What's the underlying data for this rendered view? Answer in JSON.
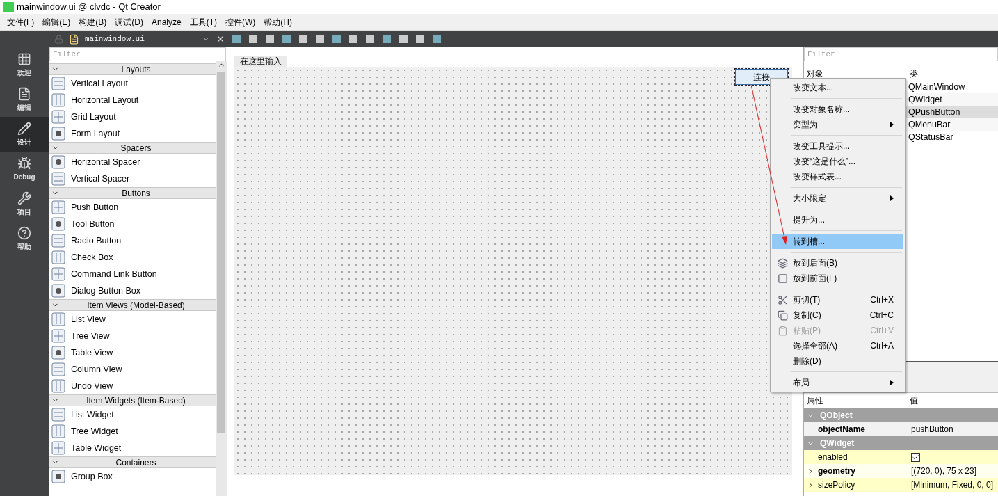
{
  "window": {
    "title": "mainwindow.ui @ clvdc - Qt Creator"
  },
  "menubar": [
    "文件(F)",
    "编辑(E)",
    "构建(B)",
    "调试(D)",
    "Analyze",
    "工具(T)",
    "控件(W)",
    "帮助(H)"
  ],
  "editor_toolbar": {
    "file": "mainwindow.ui"
  },
  "modes": [
    {
      "label": "欢迎",
      "selected": false
    },
    {
      "label": "编辑",
      "selected": false
    },
    {
      "label": "设计",
      "selected": true
    },
    {
      "label": "Debug",
      "selected": false
    },
    {
      "label": "项目",
      "selected": false
    },
    {
      "label": "帮助",
      "selected": false
    }
  ],
  "widget_box": {
    "filter_placeholder": "Filter",
    "categories": [
      {
        "title": "Layouts",
        "items": [
          "Vertical Layout",
          "Horizontal Layout",
          "Grid Layout",
          "Form Layout"
        ]
      },
      {
        "title": "Spacers",
        "items": [
          "Horizontal Spacer",
          "Vertical Spacer"
        ]
      },
      {
        "title": "Buttons",
        "items": [
          "Push Button",
          "Tool Button",
          "Radio Button",
          "Check Box",
          "Command Link Button",
          "Dialog Button Box"
        ]
      },
      {
        "title": "Item Views (Model-Based)",
        "items": [
          "List View",
          "Tree View",
          "Table View",
          "Column View",
          "Undo View"
        ]
      },
      {
        "title": "Item Widgets (Item-Based)",
        "items": [
          "List Widget",
          "Tree Widget",
          "Table Widget"
        ]
      },
      {
        "title": "Containers",
        "items": [
          "Group Box"
        ]
      }
    ]
  },
  "form": {
    "menu_placeholder": "在这里输入",
    "button": "连接"
  },
  "object_inspector": {
    "filter_placeholder": "Filter",
    "columns": [
      "对象",
      "类"
    ],
    "rows": [
      {
        "class": "QMainWindow",
        "selected": false
      },
      {
        "class": "QWidget",
        "selected": false
      },
      {
        "class": "QPushButton",
        "selected": true
      },
      {
        "class": "QMenuBar",
        "selected": false
      },
      {
        "class": "QStatusBar",
        "selected": false
      }
    ]
  },
  "context_menu": [
    {
      "kind": "item",
      "label": "改变文本...",
      "selected": false,
      "disabled": false,
      "submenu": false
    },
    {
      "kind": "separator"
    },
    {
      "kind": "item",
      "label": "改变对象名称...",
      "selected": false,
      "disabled": false,
      "submenu": false
    },
    {
      "kind": "item",
      "label": "变型为",
      "selected": false,
      "disabled": false,
      "submenu": true
    },
    {
      "kind": "separator"
    },
    {
      "kind": "item",
      "label": "改变工具提示...",
      "selected": false,
      "disabled": false,
      "submenu": false
    },
    {
      "kind": "item",
      "label": "改变“这是什么”...",
      "selected": false,
      "disabled": false,
      "submenu": false
    },
    {
      "kind": "item",
      "label": "改变样式表...",
      "selected": false,
      "disabled": false,
      "submenu": false
    },
    {
      "kind": "separator"
    },
    {
      "kind": "item",
      "label": "大小限定",
      "selected": false,
      "disabled": false,
      "submenu": true
    },
    {
      "kind": "separator"
    },
    {
      "kind": "item",
      "label": "提升为...",
      "selected": false,
      "disabled": false,
      "submenu": false
    },
    {
      "kind": "separator"
    },
    {
      "kind": "item",
      "label": "转到槽...",
      "selected": true,
      "disabled": false,
      "submenu": false
    },
    {
      "kind": "separator"
    },
    {
      "kind": "item",
      "label": "放到后面(B)",
      "selected": false,
      "disabled": false,
      "submenu": false
    },
    {
      "kind": "item",
      "label": "放到前面(F)",
      "selected": false,
      "disabled": false,
      "submenu": false
    },
    {
      "kind": "separator"
    },
    {
      "kind": "item",
      "label": "剪切(T)",
      "shortcut": "Ctrl+X",
      "selected": false,
      "disabled": false,
      "submenu": false
    },
    {
      "kind": "item",
      "label": "复制(C)",
      "shortcut": "Ctrl+C",
      "selected": false,
      "disabled": false,
      "submenu": false
    },
    {
      "kind": "item",
      "label": "粘贴(P)",
      "shortcut": "Ctrl+V",
      "selected": false,
      "disabled": true,
      "submenu": false
    },
    {
      "kind": "item",
      "label": "选择全部(A)",
      "shortcut": "Ctrl+A",
      "selected": false,
      "disabled": false,
      "submenu": false
    },
    {
      "kind": "item",
      "label": "删除(D)",
      "selected": false,
      "disabled": false,
      "submenu": false
    },
    {
      "kind": "separator"
    },
    {
      "kind": "item",
      "label": "布局",
      "selected": false,
      "disabled": false,
      "submenu": true
    }
  ],
  "property_editor": {
    "columns": [
      "属性",
      "值"
    ],
    "rows": [
      {
        "kind": "group",
        "name": "QObject",
        "expanded": true
      },
      {
        "kind": "property",
        "name": "objectName",
        "value": "pushButton",
        "bold": true,
        "expandable": false
      },
      {
        "kind": "group",
        "name": "QWidget",
        "expanded": true
      },
      {
        "kind": "checkbox",
        "name": "enabled",
        "checked": true,
        "bold": false,
        "expandable": false
      },
      {
        "kind": "property",
        "name": "geometry",
        "value": "[(720, 0), 75 x 23]",
        "bold": true,
        "expandable": true
      },
      {
        "kind": "property",
        "name": "sizePolicy",
        "value": "[Minimum, Fixed, 0, 0]",
        "bold": false,
        "expandable": true
      }
    ]
  }
}
